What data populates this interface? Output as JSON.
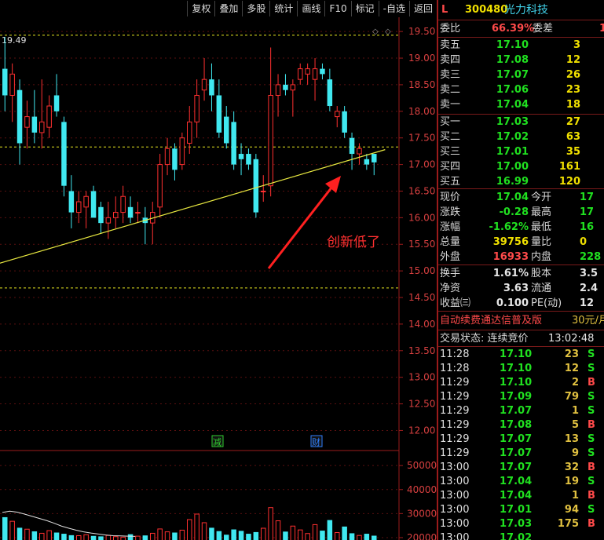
{
  "toolbar": {
    "buttons": [
      "复权",
      "叠加",
      "多股",
      "统计",
      "画线",
      "F10",
      "标记",
      "-自选",
      "返回"
    ]
  },
  "chart": {
    "high_label": "19.49",
    "annotation": "创新低了",
    "event_marks": [
      "减",
      "财"
    ],
    "price_ticks": [
      "19.50",
      "19.00",
      "18.50",
      "18.00",
      "17.50",
      "17.00",
      "16.50",
      "16.00",
      "15.50",
      "15.00",
      "14.50",
      "14.00",
      "13.50",
      "13.00",
      "12.50",
      "12.00"
    ],
    "volume_ticks": [
      "50000",
      "40000",
      "30000",
      "20000"
    ],
    "colors": {
      "up": "#ff3030",
      "down": "#40e8f0",
      "axis": "#9b1b1b",
      "trendline": "#e8e840",
      "guide": "#e8e820"
    }
  },
  "chart_data": {
    "type": "candlestick",
    "price_axis": {
      "min": 11.8,
      "max": 19.65
    },
    "candles": [
      {
        "o": 18.8,
        "h": 19.4,
        "l": 18.0,
        "c": 18.3
      },
      {
        "o": 18.3,
        "h": 18.9,
        "l": 17.8,
        "c": 18.7
      },
      {
        "o": 18.4,
        "h": 18.6,
        "l": 17.0,
        "c": 17.4
      },
      {
        "o": 17.7,
        "h": 18.2,
        "l": 17.3,
        "c": 17.9
      },
      {
        "o": 17.9,
        "h": 18.4,
        "l": 17.4,
        "c": 17.6
      },
      {
        "o": 17.6,
        "h": 18.6,
        "l": 17.3,
        "c": 17.8
      },
      {
        "o": 17.7,
        "h": 18.3,
        "l": 17.5,
        "c": 18.1
      },
      {
        "o": 18.3,
        "h": 18.7,
        "l": 17.9,
        "c": 18.0
      },
      {
        "o": 17.8,
        "h": 17.9,
        "l": 16.4,
        "c": 16.6
      },
      {
        "o": 16.5,
        "h": 16.8,
        "l": 15.8,
        "c": 16.1
      },
      {
        "o": 16.1,
        "h": 16.5,
        "l": 15.9,
        "c": 16.3
      },
      {
        "o": 16.2,
        "h": 16.5,
        "l": 15.8,
        "c": 16.4
      },
      {
        "o": 16.5,
        "h": 16.6,
        "l": 16.0,
        "c": 16.0
      },
      {
        "o": 16.2,
        "h": 16.3,
        "l": 15.7,
        "c": 15.9
      },
      {
        "o": 15.9,
        "h": 16.3,
        "l": 15.6,
        "c": 16.0
      },
      {
        "o": 16.0,
        "h": 16.4,
        "l": 15.8,
        "c": 16.1
      },
      {
        "o": 16.1,
        "h": 16.6,
        "l": 15.9,
        "c": 16.4
      },
      {
        "o": 16.2,
        "h": 16.4,
        "l": 15.9,
        "c": 16.0
      },
      {
        "o": 16.1,
        "h": 16.3,
        "l": 15.9,
        "c": 16.1
      },
      {
        "o": 16.0,
        "h": 16.2,
        "l": 15.5,
        "c": 15.9
      },
      {
        "o": 15.9,
        "h": 16.3,
        "l": 15.5,
        "c": 16.1
      },
      {
        "o": 16.2,
        "h": 17.2,
        "l": 16.0,
        "c": 17.0
      },
      {
        "o": 17.0,
        "h": 17.5,
        "l": 16.8,
        "c": 17.3
      },
      {
        "o": 17.3,
        "h": 17.4,
        "l": 16.7,
        "c": 16.9
      },
      {
        "o": 17.0,
        "h": 17.6,
        "l": 16.9,
        "c": 17.5
      },
      {
        "o": 17.4,
        "h": 18.1,
        "l": 17.2,
        "c": 17.8
      },
      {
        "o": 17.8,
        "h": 18.6,
        "l": 17.5,
        "c": 18.3
      },
      {
        "o": 18.4,
        "h": 19.0,
        "l": 18.2,
        "c": 18.6
      },
      {
        "o": 18.6,
        "h": 18.9,
        "l": 18.0,
        "c": 18.3
      },
      {
        "o": 18.3,
        "h": 18.6,
        "l": 17.5,
        "c": 17.6
      },
      {
        "o": 17.9,
        "h": 18.1,
        "l": 17.3,
        "c": 17.4
      },
      {
        "o": 17.8,
        "h": 18.0,
        "l": 16.9,
        "c": 17.0
      },
      {
        "o": 17.2,
        "h": 17.4,
        "l": 16.8,
        "c": 17.1
      },
      {
        "o": 17.2,
        "h": 17.3,
        "l": 16.9,
        "c": 17.0
      },
      {
        "o": 17.1,
        "h": 17.2,
        "l": 16.0,
        "c": 16.1
      },
      {
        "o": 16.5,
        "h": 16.8,
        "l": 16.3,
        "c": 16.5
      },
      {
        "o": 16.6,
        "h": 19.2,
        "l": 16.4,
        "c": 18.3
      },
      {
        "o": 18.3,
        "h": 18.7,
        "l": 17.9,
        "c": 18.5
      },
      {
        "o": 18.5,
        "h": 18.7,
        "l": 18.3,
        "c": 18.4
      },
      {
        "o": 18.4,
        "h": 18.6,
        "l": 17.9,
        "c": 18.5
      },
      {
        "o": 18.6,
        "h": 18.9,
        "l": 18.5,
        "c": 18.8
      },
      {
        "o": 18.7,
        "h": 18.9,
        "l": 18.5,
        "c": 18.8
      },
      {
        "o": 18.6,
        "h": 19.0,
        "l": 18.2,
        "c": 18.8
      },
      {
        "o": 18.8,
        "h": 18.9,
        "l": 18.6,
        "c": 18.7
      },
      {
        "o": 18.6,
        "h": 18.8,
        "l": 18.0,
        "c": 18.1
      },
      {
        "o": 17.9,
        "h": 18.1,
        "l": 17.7,
        "c": 18.0
      },
      {
        "o": 18.0,
        "h": 18.1,
        "l": 17.5,
        "c": 17.6
      },
      {
        "o": 17.5,
        "h": 17.6,
        "l": 16.9,
        "c": 17.2
      },
      {
        "o": 17.2,
        "h": 17.4,
        "l": 17.0,
        "c": 17.3
      },
      {
        "o": 17.1,
        "h": 17.2,
        "l": 16.9,
        "c": 17.0
      },
      {
        "o": 17.2,
        "h": 17.2,
        "l": 16.8,
        "c": 17.04
      }
    ],
    "trendline": {
      "from": {
        "i": -3,
        "p": 15.05
      },
      "to": {
        "i": 51.5,
        "p": 17.28
      }
    },
    "guides": [
      19.43,
      17.33,
      14.68
    ],
    "volume_axis": {
      "min": 19000,
      "max": 53000
    },
    "volumes": [
      28500,
      26800,
      24100,
      23500,
      22600,
      21800,
      22900,
      22100,
      21600,
      21000,
      20800,
      21200,
      20700,
      20500,
      20900,
      20400,
      20200,
      21400,
      20600,
      20900,
      21800,
      23600,
      22400,
      22100,
      23100,
      27500,
      29800,
      26200,
      24100,
      22700,
      21200,
      23400,
      22800,
      21600,
      22300,
      23900,
      32500,
      27000,
      22500,
      24800,
      23200,
      21700,
      25400,
      22900,
      27300,
      22100,
      24600,
      21800,
      20900,
      21600,
      20800
    ],
    "ma_line": [
      30500,
      31000,
      30600,
      29800,
      28900,
      28000,
      27100,
      26000,
      24800,
      23900,
      23100,
      22400,
      21900,
      21500,
      21100,
      20800,
      20700,
      20600,
      20500
    ]
  },
  "quote": {
    "code": "300480",
    "name": "光力科技",
    "flag": "L",
    "ratio_label": "委比",
    "ratio_value": "66.39%",
    "diff_label": "委差",
    "diff_value": "1",
    "sell": [
      {
        "label": "卖五",
        "price": "17.10",
        "vol": "3"
      },
      {
        "label": "卖四",
        "price": "17.08",
        "vol": "12"
      },
      {
        "label": "卖三",
        "price": "17.07",
        "vol": "26"
      },
      {
        "label": "卖二",
        "price": "17.06",
        "vol": "23"
      },
      {
        "label": "卖一",
        "price": "17.04",
        "vol": "18"
      }
    ],
    "buy": [
      {
        "label": "买一",
        "price": "17.03",
        "vol": "27"
      },
      {
        "label": "买二",
        "price": "17.02",
        "vol": "63"
      },
      {
        "label": "买三",
        "price": "17.01",
        "vol": "35"
      },
      {
        "label": "买四",
        "price": "17.00",
        "vol": "161"
      },
      {
        "label": "买五",
        "price": "16.99",
        "vol": "120"
      }
    ],
    "stats": [
      {
        "l1": "现价",
        "v1": "17.04",
        "c1": "green",
        "l2": "今开",
        "v2": "17",
        "c2": "green"
      },
      {
        "l1": "涨跌",
        "v1": "-0.28",
        "c1": "green",
        "l2": "最高",
        "v2": "17",
        "c2": "green"
      },
      {
        "l1": "涨幅",
        "v1": "-1.62%",
        "c1": "green",
        "l2": "最低",
        "v2": "16",
        "c2": "green"
      },
      {
        "l1": "总量",
        "v1": "39756",
        "c1": "yellow",
        "l2": "量比",
        "v2": "0",
        "c2": "yellow"
      },
      {
        "l1": "外盘",
        "v1": "16933",
        "c1": "red",
        "l2": "内盘",
        "v2": "228",
        "c2": "green"
      }
    ],
    "finance": [
      {
        "l1": "换手",
        "v1": "1.61%",
        "l2": "股本",
        "v2": "3.5"
      },
      {
        "l1": "净资",
        "v1": "3.63",
        "l2": "流通",
        "v2": "2.4"
      },
      {
        "l1": "收益㈢",
        "v1": "0.100",
        "l2": "PE(动)",
        "v2": "12"
      }
    ],
    "promo": "自动续费通达信普及版",
    "promo_price": "30元/月",
    "status_label": "交易状态: 连续竞价",
    "status_time": "13:02:48",
    "ticks": [
      {
        "t": "11:28",
        "p": "17.10",
        "v": "23",
        "s": "S"
      },
      {
        "t": "11:28",
        "p": "17.10",
        "v": "12",
        "s": "S"
      },
      {
        "t": "11:29",
        "p": "17.10",
        "v": "2",
        "s": "B"
      },
      {
        "t": "11:29",
        "p": "17.09",
        "v": "79",
        "s": "S"
      },
      {
        "t": "11:29",
        "p": "17.07",
        "v": "1",
        "s": "S"
      },
      {
        "t": "11:29",
        "p": "17.08",
        "v": "5",
        "s": "B"
      },
      {
        "t": "11:29",
        "p": "17.07",
        "v": "13",
        "s": "S"
      },
      {
        "t": "11:29",
        "p": "17.07",
        "v": "9",
        "s": "S"
      },
      {
        "t": "13:00",
        "p": "17.07",
        "v": "32",
        "s": "B"
      },
      {
        "t": "13:00",
        "p": "17.04",
        "v": "19",
        "s": "S"
      },
      {
        "t": "13:00",
        "p": "17.04",
        "v": "1",
        "s": "B"
      },
      {
        "t": "13:00",
        "p": "17.01",
        "v": "94",
        "s": "S"
      },
      {
        "t": "13:00",
        "p": "17.03",
        "v": "175",
        "s": "B"
      },
      {
        "t": "13:00",
        "p": "17.02",
        "v": "",
        "s": ""
      }
    ]
  }
}
